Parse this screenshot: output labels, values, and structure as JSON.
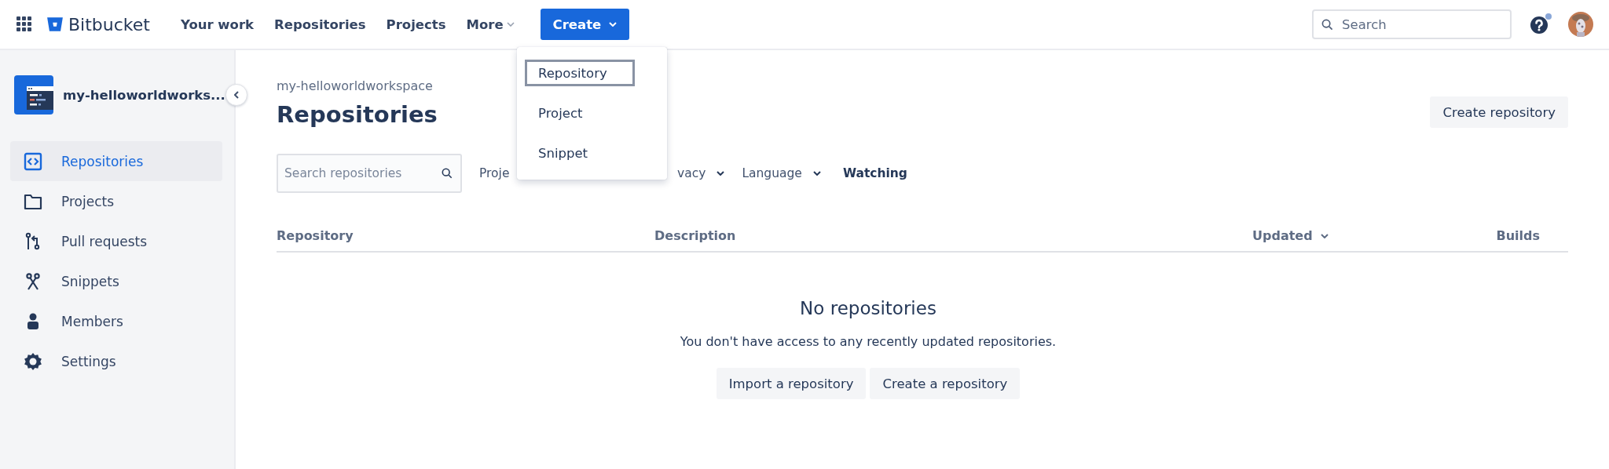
{
  "topbar": {
    "app_name": "Bitbucket",
    "nav": [
      {
        "label": "Your work",
        "kind": "link"
      },
      {
        "label": "Repositories",
        "kind": "link"
      },
      {
        "label": "Projects",
        "kind": "link"
      },
      {
        "label": "More",
        "kind": "dropdown"
      }
    ],
    "create_button": "Create",
    "search": {
      "placeholder": "Search"
    },
    "help_notification": true
  },
  "create_menu": {
    "items": [
      {
        "label": "Repository",
        "focused": true
      },
      {
        "label": "Project",
        "focused": false
      },
      {
        "label": "Snippet",
        "focused": false
      }
    ]
  },
  "sidebar": {
    "workspace": "my-helloworldworks...",
    "items": [
      {
        "label": "Repositories",
        "selected": true
      },
      {
        "label": "Projects",
        "selected": false
      },
      {
        "label": "Pull requests",
        "selected": false
      },
      {
        "label": "Snippets",
        "selected": false
      },
      {
        "label": "Members",
        "selected": false
      },
      {
        "label": "Settings",
        "selected": false
      }
    ]
  },
  "breadcrumb": "my-helloworldworkspace",
  "title": "Repositories",
  "create_repository_button": "Create repository",
  "filters": {
    "search_placeholder": "Search repositories",
    "items": [
      {
        "label": "Proje",
        "kind": "partial"
      },
      {
        "label": "vacy",
        "kind": "dropdown"
      },
      {
        "label": "Language",
        "kind": "dropdown"
      },
      {
        "label": "Watching",
        "kind": "toggle"
      }
    ]
  },
  "table": {
    "columns": [
      {
        "label": "Repository",
        "sorted": false
      },
      {
        "label": "Description",
        "sorted": false
      },
      {
        "label": "Updated",
        "sorted": true
      },
      {
        "label": "Builds",
        "sorted": false
      }
    ]
  },
  "empty_state": {
    "title": "No repositories",
    "message": "You don't have access to any recently updated repositories.",
    "buttons": [
      "Import a repository",
      "Create a repository"
    ]
  }
}
